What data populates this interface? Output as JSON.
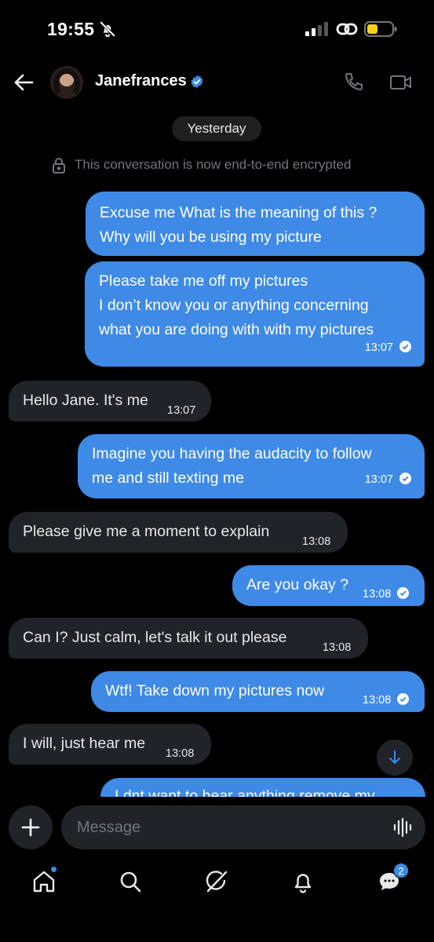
{
  "status_bar": {
    "time": "19:55"
  },
  "header": {
    "contact_name": "Janefrances"
  },
  "chat": {
    "date_label": "Yesterday",
    "encryption_notice": "This conversation is now end-to-end encrypted",
    "messages": [
      {
        "direction": "sent",
        "lines": [
          "Excuse me What is the meaning of this ?",
          "Why will you be using my picture"
        ],
        "time": ""
      },
      {
        "direction": "sent",
        "lines": [
          "Please take me off my pictures",
          "I don’t know you or anything concerning",
          "what you are doing with with my pictures"
        ],
        "time": "13:07"
      },
      {
        "direction": "received",
        "lines": [
          "Hello Jane. It's me"
        ],
        "time": "13:07"
      },
      {
        "direction": "sent",
        "lines": [
          "Imagine you having the audacity to follow",
          "me and still texting me"
        ],
        "time": "13:07"
      },
      {
        "direction": "received",
        "lines": [
          "Please give me a moment to explain"
        ],
        "time": "13:08"
      },
      {
        "direction": "sent",
        "lines": [
          "Are you okay ?"
        ],
        "time": "13:08"
      },
      {
        "direction": "received",
        "lines": [
          "Can I? Just calm, let's talk it out please"
        ],
        "time": "13:08"
      },
      {
        "direction": "sent",
        "lines": [
          "Wtf!  Take down my pictures now"
        ],
        "time": "13:08"
      },
      {
        "direction": "received",
        "lines": [
          "I will, just hear me"
        ],
        "time": "13:08"
      },
      {
        "direction": "sent",
        "lines": [
          "I dnt want to hear anything remove my"
        ],
        "time": ""
      }
    ]
  },
  "composer": {
    "placeholder": "Message"
  },
  "bottom_nav": {
    "items": [
      "home",
      "search",
      "grok",
      "notifications",
      "messages"
    ],
    "messages_badge": "2"
  },
  "colors": {
    "accent": "#3e8ae6",
    "received_bubble": "#202327",
    "background": "#000000"
  }
}
